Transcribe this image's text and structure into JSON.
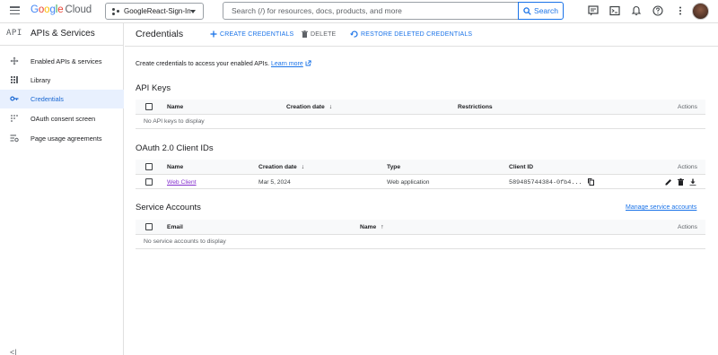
{
  "topbar": {
    "logo": {
      "google": "Google",
      "cloud": "Cloud"
    },
    "project": "GoogleReact-Sign-In",
    "search_placeholder": "Search (/) for resources, docs, products, and more",
    "search_button": "Search",
    "icons": [
      "menu-icon",
      "notes-icon",
      "terminal-icon",
      "bell-icon",
      "help-icon",
      "more-vert-icon"
    ]
  },
  "sidebar": {
    "api_mark": "API",
    "title": "APIs & Services",
    "items": [
      {
        "label": "Enabled APIs & services",
        "icon": "move-icon",
        "active": false
      },
      {
        "label": "Library",
        "icon": "library-icon",
        "active": false
      },
      {
        "label": "Credentials",
        "icon": "key-icon",
        "active": true
      },
      {
        "label": "OAuth consent screen",
        "icon": "consent-icon",
        "active": false
      },
      {
        "label": "Page usage agreements",
        "icon": "settings-list-icon",
        "active": false
      }
    ],
    "collapse": "<|"
  },
  "header": {
    "title": "Credentials",
    "create": "CREATE CREDENTIALS",
    "delete": "DELETE",
    "restore": "RESTORE DELETED CREDENTIALS"
  },
  "intro": {
    "text": "Create credentials to access your enabled APIs.",
    "link": "Learn more"
  },
  "api_keys": {
    "title": "API Keys",
    "columns": [
      "Name",
      "Creation date",
      "Restrictions",
      "Actions"
    ],
    "empty": "No API keys to display"
  },
  "oauth": {
    "title": "OAuth 2.0 Client IDs",
    "columns": [
      "Name",
      "Creation date",
      "Type",
      "Client ID",
      "Actions"
    ],
    "rows": [
      {
        "name": "Web Client",
        "date": "Mar 5, 2024",
        "type": "Web application",
        "client_id": "589485744384-0fb4..."
      }
    ]
  },
  "service_accounts": {
    "title": "Service Accounts",
    "manage": "Manage service accounts",
    "columns": [
      "Email",
      "Name",
      "Actions"
    ],
    "empty": "No service accounts to display"
  },
  "colors": {
    "accent": "#1a73e8",
    "active_bg": "#e8f0fe",
    "link_visited": "#8430ce"
  }
}
